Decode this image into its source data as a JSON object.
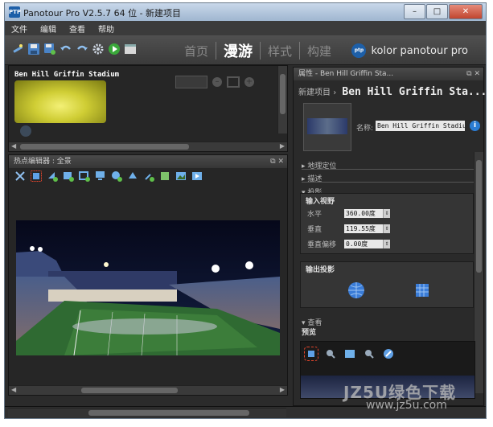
{
  "window": {
    "title": "Panotour Pro V2.5.7 64 位 - 新建项目",
    "app_icon": "PTP",
    "buttons": {
      "minimize": "–",
      "maximize": "□",
      "close": "✕"
    }
  },
  "menu": {
    "items": [
      "文件",
      "编辑",
      "查看",
      "帮助"
    ]
  },
  "toolbar": {
    "icons": [
      "magic-wand-icon",
      "save-icon",
      "save-as-icon",
      "undo-icon",
      "redo-icon",
      "gear-icon",
      "play-icon",
      "window-icon"
    ],
    "mode_tabs": [
      "首页",
      "漫游",
      "样式",
      "构建"
    ],
    "active_tab": "漫游",
    "brand": "kolor panotour pro",
    "brand_logo": "ptp"
  },
  "pano_list": {
    "pano_label": "Ben Hill Griffin Stadium"
  },
  "hotspot_editor": {
    "header": "热点编辑器 : 全景",
    "buttons": {
      "float": "⧉",
      "close": "✕"
    }
  },
  "properties": {
    "header": "属性 - Ben Hill Griffin Sta...",
    "breadcrumb_root": "新建项目",
    "breadcrumb_sep": "›",
    "breadcrumb_title": "Ben Hill Griffin Sta...",
    "name_label": "名称:",
    "name_value": "Ben Hill Griffin Stadium",
    "info": "i",
    "sections": {
      "geo": "地理定位",
      "desc": "描述",
      "projection": "投影"
    },
    "input_view": {
      "title": "输入视野",
      "rows": [
        {
          "label": "水平",
          "value": "360.00度"
        },
        {
          "label": "垂直",
          "value": "119.55度"
        },
        {
          "label": "垂直偏移",
          "value": "0.00度"
        }
      ]
    },
    "output_projection": {
      "title": "输出投影",
      "icons": [
        "sphere-icon",
        "cube-icon"
      ]
    },
    "view_section": "查看",
    "preview": {
      "title": "预览",
      "icons": [
        "select-icon",
        "pin-icon",
        "frame-icon",
        "pin2-icon",
        "compass-icon"
      ]
    }
  },
  "colors": {
    "bg": "#2b2b2b",
    "accent": "#1d5fa8",
    "thumb_yellow": "#cfcd34",
    "close_red": "#c1452f"
  },
  "watermark": {
    "text": "JZ5U绿色下载",
    "url": "www.jz5u.com"
  }
}
